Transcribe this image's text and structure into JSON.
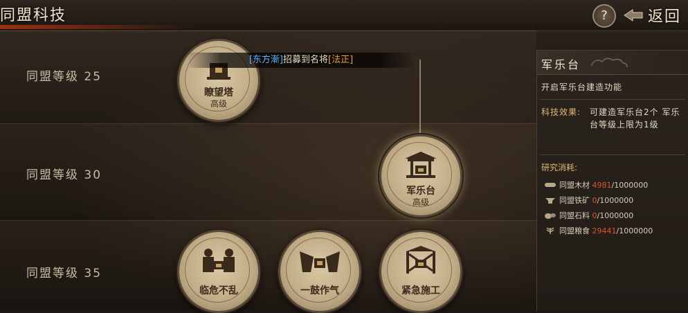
{
  "header": {
    "title": "同盟科技",
    "help_label": "?",
    "back_label": "返回"
  },
  "levels": [
    {
      "label": "同盟等级 25"
    },
    {
      "label": "同盟等级 30"
    },
    {
      "label": "同盟等级 35"
    }
  ],
  "nodes": [
    {
      "name": "瞭望塔",
      "tag": "高级"
    },
    {
      "name": "军乐台",
      "tag": "高级"
    },
    {
      "name": "临危不乱",
      "tag": ""
    },
    {
      "name": "一鼓作气",
      "tag": ""
    },
    {
      "name": "紧急施工",
      "tag": ""
    }
  ],
  "marquee": {
    "player": "[东方漸]",
    "middle": "招募到名将",
    "general": "[法正]"
  },
  "panel": {
    "title": "军乐台",
    "description": "开启军乐台建造功能",
    "effect_label": "科技效果:",
    "effect_text": "可建造军乐台2个 军乐台等级上限为1级",
    "cost_label": "研究消耗:",
    "costs": [
      {
        "name": "同盟木材",
        "current": "4981",
        "total": "/1000000",
        "icon": "wood-icon"
      },
      {
        "name": "同盟铁矿",
        "current": "0",
        "total": "/1000000",
        "icon": "iron-icon"
      },
      {
        "name": "同盟石料",
        "current": "0",
        "total": "/1000000",
        "icon": "stone-icon"
      },
      {
        "name": "同盟粮食",
        "current": "29441",
        "total": "/1000000",
        "icon": "grain-icon"
      }
    ]
  },
  "colors": {
    "accent_title_glow": "#aa3214",
    "cost_current": "#e0542a",
    "effect_label": "#e2b870",
    "marquee_player": "#5fb6ff",
    "marquee_general": "#f0a040"
  }
}
